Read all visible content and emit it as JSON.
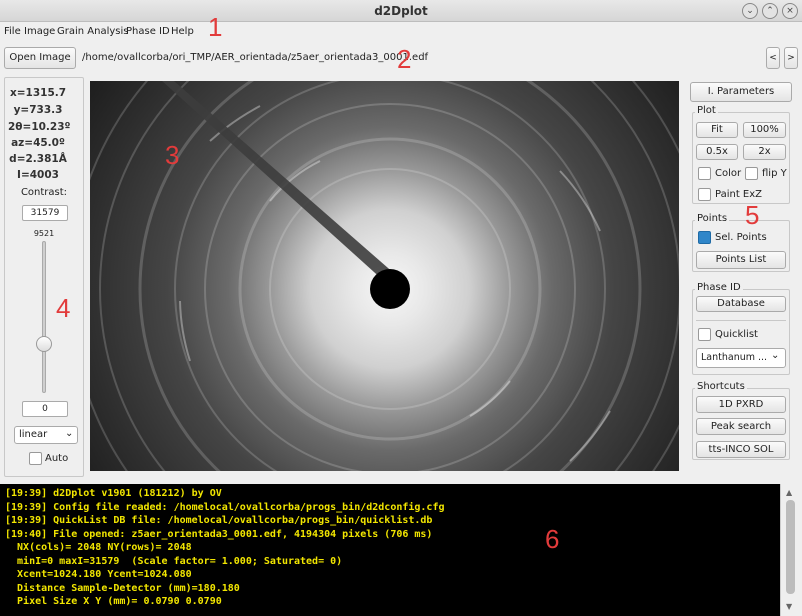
{
  "window": {
    "title": "d2Dplot"
  },
  "menu": [
    "File",
    "Image",
    "Grain Analysis",
    "Phase ID",
    "Help"
  ],
  "toolbar": {
    "open_label": "Open Image",
    "path": "/home/ovallcorba/ori_TMP/AER_orientada/z5aer_orientada3_0001.edf",
    "prev": "<",
    "next": ">"
  },
  "info": {
    "x": "x=1315.7",
    "y": "y=733.3",
    "two_theta": "2θ=10.23º",
    "az": "az=45.0º",
    "d": "d=2.381Å",
    "i": "I=4003",
    "contrast_label": "Contrast:",
    "contrast_value": "31579",
    "slider_max": "9521",
    "slider_level": 0.3,
    "slider_min": "0",
    "scale": "linear",
    "auto": "Auto"
  },
  "right": {
    "iparams": "I. Parameters",
    "plot_title": "Plot",
    "fit": "Fit",
    "p100": "100%",
    "half": "0.5x",
    "double": "2x",
    "color": "Color",
    "flipy": "flip Y",
    "paint": "Paint ExZ",
    "points_title": "Points",
    "sel_points": "Sel. Points",
    "points_list": "Points List",
    "phase_title": "Phase ID",
    "database": "Database",
    "quicklist": "Quicklist",
    "lanthanum": "Lanthanum ...",
    "shortcuts_title": "Shortcuts",
    "pxrd": "1D PXRD",
    "peak": "Peak search",
    "tts": "tts-INCO SOL"
  },
  "console": [
    "[19:39] d2Dplot v1901 (181212) by OV",
    "[19:39] Config file readed: /homelocal/ovallcorba/progs_bin/d2dconfig.cfg",
    "[19:39] QuickList DB file: /homelocal/ovallcorba/progs_bin/quicklist.db",
    "[19:40] File opened: z5aer_orientada3_0001.edf, 4194304 pixels (706 ms)",
    "  NX(cols)= 2048 NY(rows)= 2048",
    "  minI=0 maxI=31579  (Scale factor= 1.000; Saturated= 0)",
    "  Xcent=1024.180 Ycent=1024.080",
    "  Distance Sample-Detector (mm)=180.180",
    "  Pixel Size X Y (mm)= 0.0790 0.0790"
  ],
  "annotations": [
    "1",
    "2",
    "3",
    "4",
    "5",
    "6"
  ]
}
